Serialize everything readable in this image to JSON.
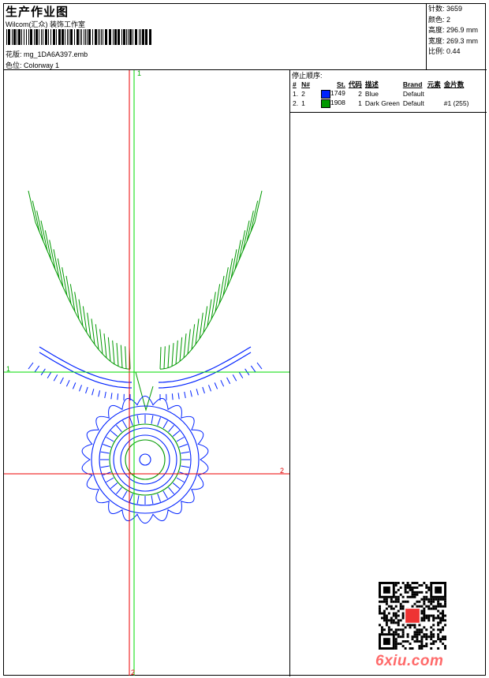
{
  "header": {
    "title": "生产作业图",
    "company": "Wilcom(汇众) 装饰工作室",
    "design_label": "花版:",
    "design_value": "mg_1DA6A397.emb",
    "colorway_label": "色位:",
    "colorway_value": "Colorway 1"
  },
  "stats": [
    {
      "label": "针数:",
      "value": "3659"
    },
    {
      "label": "颜色:",
      "value": "2"
    },
    {
      "label": "高度:",
      "value": "296.9 mm"
    },
    {
      "label": "宽度:",
      "value": "269.3 mm"
    },
    {
      "label": "比例:",
      "value": "0.44"
    }
  ],
  "stop_sequence": {
    "title": "停止顺序:",
    "columns": [
      "#",
      "N#",
      "St.",
      "代码",
      "描述",
      "Brand",
      "元素",
      "金片数"
    ],
    "rows": [
      {
        "idx": "1.",
        "n": "2",
        "color": "#0022ff",
        "st": "1749",
        "code": "2",
        "desc": "Blue",
        "brand": "Default",
        "element": "",
        "sequins": ""
      },
      {
        "idx": "2.",
        "n": "1",
        "color": "#009900",
        "st": "1908",
        "code": "1",
        "desc": "Dark Green",
        "brand": "Default",
        "element": "",
        "sequins": "#1 (255)"
      }
    ]
  },
  "axes": {
    "v1": "1",
    "v2": "2",
    "h1": "1",
    "h2": "2",
    "color_green": "#00dd00",
    "color_red": "#ee0000"
  },
  "colors": {
    "blue": "#0022ff",
    "green": "#009900"
  },
  "watermark": "6xiu.com"
}
